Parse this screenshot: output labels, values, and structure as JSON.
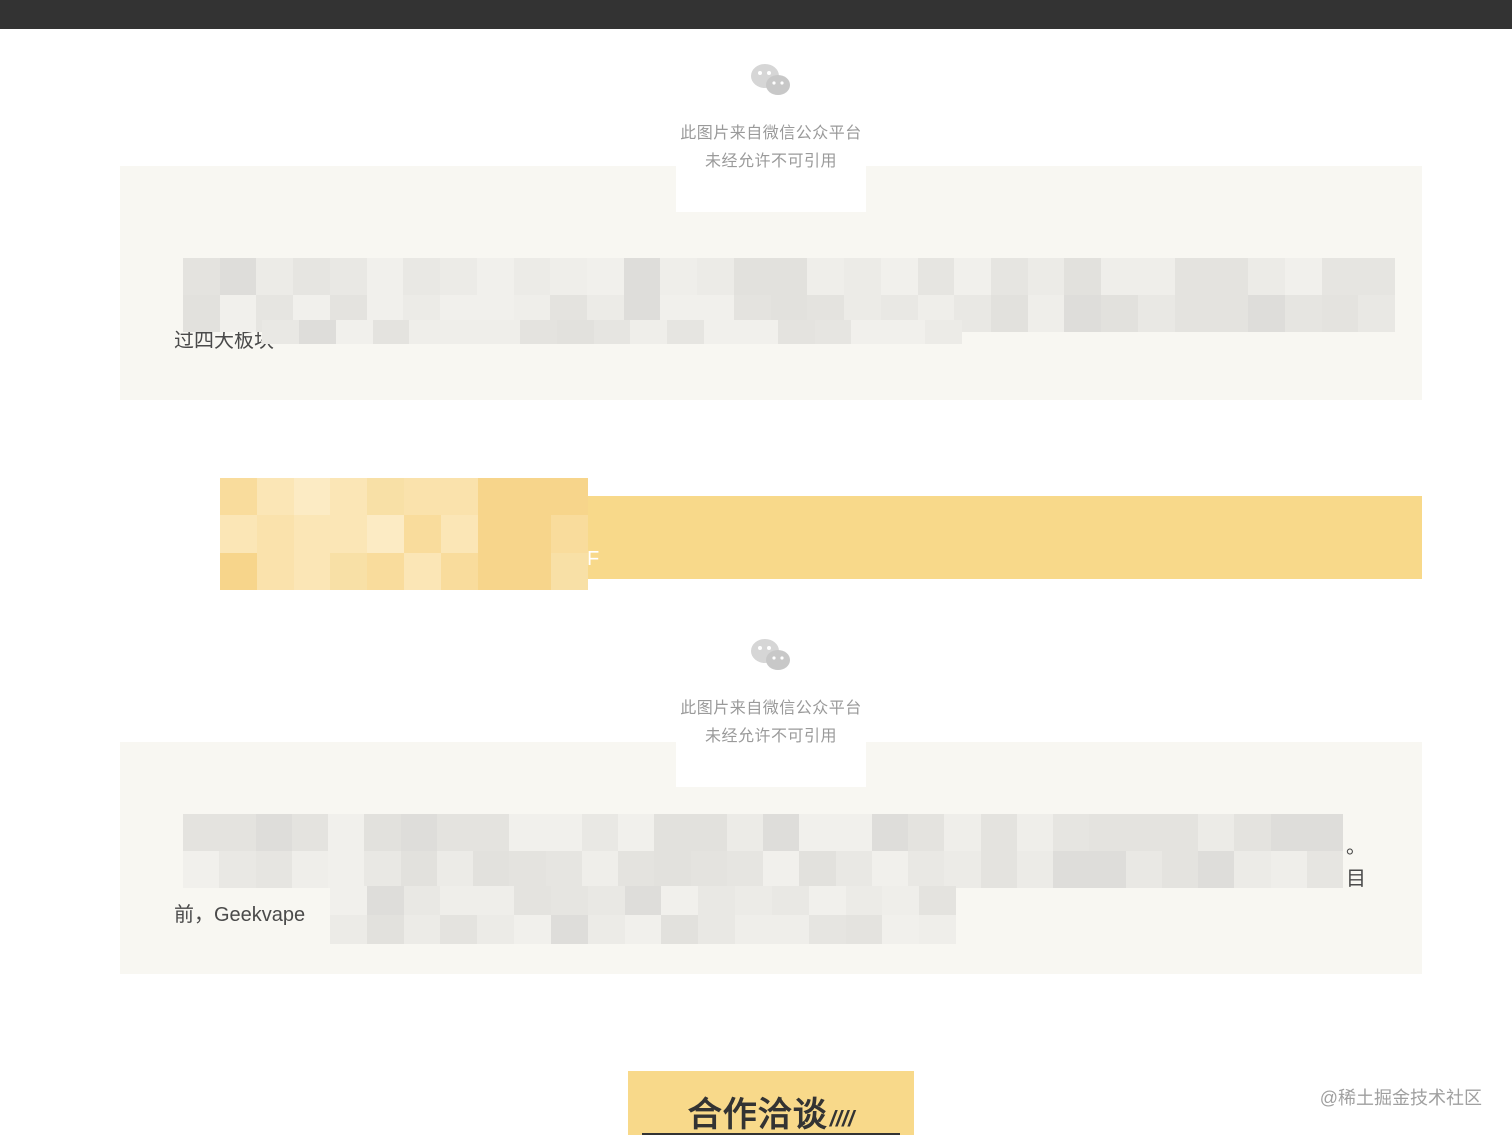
{
  "image_notice": {
    "line1": "此图片来自微信公众平台",
    "line2": "未经允许不可引用"
  },
  "section1": {
    "visible_text": "过四大板块"
  },
  "section2": {
    "visible_text_start": "前，Geekvape",
    "visible_text_end_1": "。",
    "visible_text_end_2": "目"
  },
  "banner": {
    "accent_color": "#f8d98a"
  },
  "cta": {
    "label": "合作洽谈",
    "decoration": "////"
  },
  "watermark": "@稀土掘金技术社区",
  "colors": {
    "topbar": "#333333",
    "card_background": "#f8f7f2",
    "accent": "#f8d98a"
  },
  "icons": {
    "placeholder": "wechat-icon"
  }
}
